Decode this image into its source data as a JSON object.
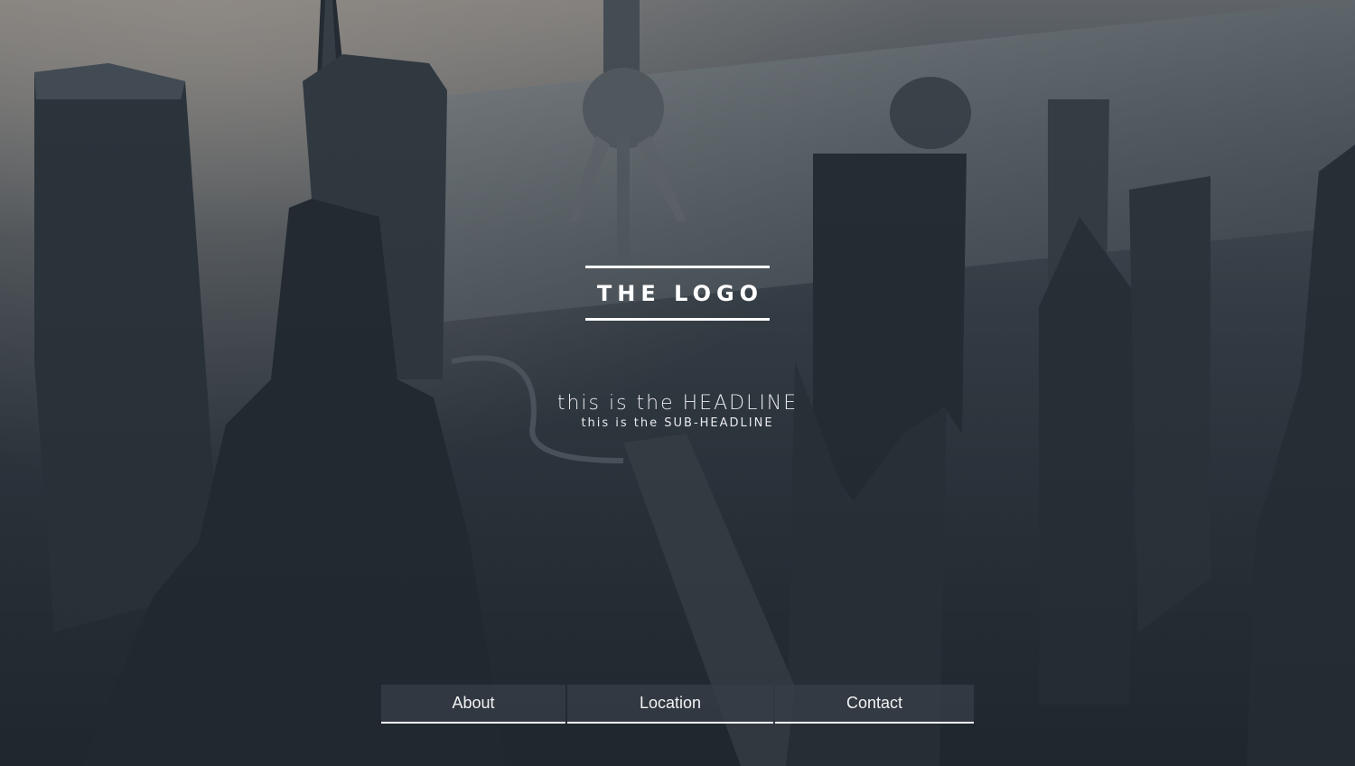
{
  "logo": {
    "text": "THE LOGO"
  },
  "hero": {
    "headline": "this is the HEADLINE",
    "subheadline": "this is the SUB-HEADLINE",
    "background_description_icon": "city-skyline-photo"
  },
  "nav": {
    "items": [
      {
        "label": "About"
      },
      {
        "label": "Location"
      },
      {
        "label": "Contact"
      }
    ]
  },
  "colors": {
    "text": "#ffffff",
    "nav_background": "#373e48",
    "nav_border": "#ffffff"
  }
}
